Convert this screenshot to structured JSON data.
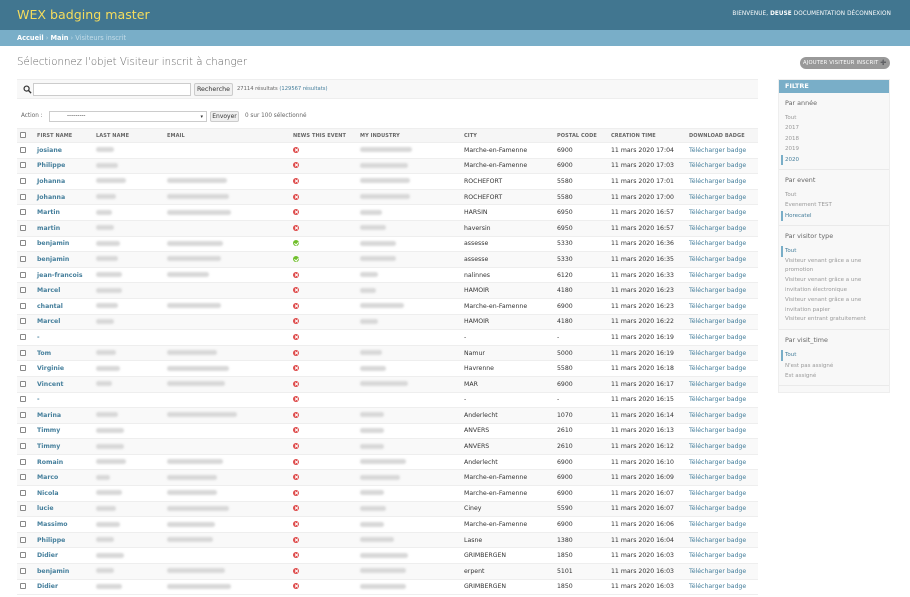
{
  "header": {
    "brand": "WEX badging master",
    "welcome": "BIENVENUE,",
    "username": "DEUSE",
    "documentation": "DOCUMENTATION",
    "logout": "DÉCONNEXION"
  },
  "breadcrumbs": {
    "home": "Accueil",
    "sep1": "›",
    "app": "Main",
    "sep2": "›",
    "current": "Visiteurs inscrit"
  },
  "page_title": "Sélectionnez l'objet Visiteur inscrit à changer",
  "add_button": "AJOUTER VISITEUR INSCRIT",
  "search": {
    "value": "",
    "button": "Recherche",
    "results": "27114 résultats",
    "total": "(129567 résultats)"
  },
  "actions": {
    "label": "Action :",
    "selected": "---------",
    "go": "Envoyer",
    "selected_count": "0 sur 100 sélectionné"
  },
  "table": {
    "headers": [
      "FIRST NAME",
      "LAST NAME",
      "EMAIL",
      "NEWS THIS EVENT",
      "MY INDUSTRY",
      "CITY",
      "POSTAL CODE",
      "CREATION TIME",
      "DOWNLOAD BADGE"
    ],
    "rows": [
      {
        "first": "josiane",
        "city": "Marche-en-Famenne",
        "postal": "6900",
        "time": "11 mars 2020 17:04",
        "news": "no",
        "has_ln": true,
        "has_email": false,
        "has_ind": true
      },
      {
        "first": "Philippe",
        "city": "Marche-en-Famenne",
        "postal": "6900",
        "time": "11 mars 2020 17:03",
        "news": "no",
        "has_ln": true,
        "has_email": false,
        "has_ind": true
      },
      {
        "first": "Johanna",
        "city": "ROCHEFORT",
        "postal": "5580",
        "time": "11 mars 2020 17:01",
        "news": "no",
        "has_ln": true,
        "has_email": true,
        "has_ind": true
      },
      {
        "first": "Johanna",
        "city": "ROCHEFORT",
        "postal": "5580",
        "time": "11 mars 2020 17:00",
        "news": "no",
        "has_ln": true,
        "has_email": true,
        "has_ind": true
      },
      {
        "first": "Martin",
        "city": "HARSIN",
        "postal": "6950",
        "time": "11 mars 2020 16:57",
        "news": "no",
        "has_ln": true,
        "has_email": true,
        "has_ind": true
      },
      {
        "first": "martin",
        "city": "haversin",
        "postal": "6950",
        "time": "11 mars 2020 16:57",
        "news": "no",
        "has_ln": true,
        "has_email": false,
        "has_ind": true
      },
      {
        "first": "benjamin",
        "city": "assesse",
        "postal": "5330",
        "time": "11 mars 2020 16:36",
        "news": "yes",
        "has_ln": true,
        "has_email": true,
        "has_ind": true
      },
      {
        "first": "benjamin",
        "city": "assesse",
        "postal": "5330",
        "time": "11 mars 2020 16:35",
        "news": "yes",
        "has_ln": true,
        "has_email": true,
        "has_ind": true
      },
      {
        "first": "jean-francois",
        "city": "nalinnes",
        "postal": "6120",
        "time": "11 mars 2020 16:33",
        "news": "no",
        "has_ln": true,
        "has_email": true,
        "has_ind": true
      },
      {
        "first": "Marcel",
        "city": "HAMOIR",
        "postal": "4180",
        "time": "11 mars 2020 16:23",
        "news": "no",
        "has_ln": true,
        "has_email": false,
        "has_ind": true
      },
      {
        "first": "chantal",
        "city": "Marche-en-Famenne",
        "postal": "6900",
        "time": "11 mars 2020 16:23",
        "news": "no",
        "has_ln": true,
        "has_email": true,
        "has_ind": true
      },
      {
        "first": "Marcel",
        "city": "HAMOIR",
        "postal": "4180",
        "time": "11 mars 2020 16:22",
        "news": "no",
        "has_ln": true,
        "has_email": false,
        "has_ind": true
      },
      {
        "first": "-",
        "city": "-",
        "postal": "-",
        "time": "11 mars 2020 16:19",
        "news": "no",
        "has_ln": false,
        "has_email": false,
        "has_ind": false,
        "dash_ln": true
      },
      {
        "first": "Tom",
        "city": "Namur",
        "postal": "5000",
        "time": "11 mars 2020 16:19",
        "news": "no",
        "has_ln": true,
        "has_email": true,
        "has_ind": true
      },
      {
        "first": "Virginie",
        "city": "Havrenne",
        "postal": "5580",
        "time": "11 mars 2020 16:18",
        "news": "no",
        "has_ln": true,
        "has_email": true,
        "has_ind": true
      },
      {
        "first": "Vincent",
        "city": "MAR",
        "postal": "6900",
        "time": "11 mars 2020 16:17",
        "news": "no",
        "has_ln": true,
        "has_email": true,
        "has_ind": true
      },
      {
        "first": "-",
        "city": "-",
        "postal": "-",
        "time": "11 mars 2020 16:15",
        "news": "no",
        "has_ln": false,
        "has_email": false,
        "has_ind": false,
        "dash_ln": true
      },
      {
        "first": "Marina",
        "city": "Anderlecht",
        "postal": "1070",
        "time": "11 mars 2020 16:14",
        "news": "no",
        "has_ln": true,
        "has_email": true,
        "has_ind": true
      },
      {
        "first": "Timmy",
        "city": "ANVERS",
        "postal": "2610",
        "time": "11 mars 2020 16:13",
        "news": "no",
        "has_ln": true,
        "has_email": false,
        "has_ind": true
      },
      {
        "first": "Timmy",
        "city": "ANVERS",
        "postal": "2610",
        "time": "11 mars 2020 16:12",
        "news": "no",
        "has_ln": true,
        "has_email": false,
        "has_ind": true
      },
      {
        "first": "Romain",
        "city": "Anderlecht",
        "postal": "6900",
        "time": "11 mars 2020 16:10",
        "news": "no",
        "has_ln": true,
        "has_email": true,
        "has_ind": true
      },
      {
        "first": "Marco",
        "city": "Marche-en-Famenne",
        "postal": "6900",
        "time": "11 mars 2020 16:09",
        "news": "no",
        "has_ln": true,
        "has_email": true,
        "has_ind": true
      },
      {
        "first": "Nicola",
        "city": "Marche-en-Famenne",
        "postal": "6900",
        "time": "11 mars 2020 16:07",
        "news": "no",
        "has_ln": true,
        "has_email": true,
        "has_ind": true
      },
      {
        "first": "lucie",
        "city": "Ciney",
        "postal": "5590",
        "time": "11 mars 2020 16:07",
        "news": "no",
        "has_ln": true,
        "has_email": true,
        "has_ind": true
      },
      {
        "first": "Massimo",
        "city": "Marche-en-Famenne",
        "postal": "6900",
        "time": "11 mars 2020 16:06",
        "news": "no",
        "has_ln": true,
        "has_email": true,
        "has_ind": true
      },
      {
        "first": "Philippe",
        "city": "Lasne",
        "postal": "1380",
        "time": "11 mars 2020 16:04",
        "news": "no",
        "has_ln": true,
        "has_email": true,
        "has_ind": true
      },
      {
        "first": "Didier",
        "city": "GRIMBERGEN",
        "postal": "1850",
        "time": "11 mars 2020 16:03",
        "news": "no",
        "has_ln": true,
        "has_email": false,
        "has_ind": true
      },
      {
        "first": "benjamin",
        "city": "erpent",
        "postal": "5101",
        "time": "11 mars 2020 16:03",
        "news": "no",
        "has_ln": true,
        "has_email": true,
        "has_ind": true
      },
      {
        "first": "Didier",
        "city": "GRIMBERGEN",
        "postal": "1850",
        "time": "11 mars 2020 16:03",
        "news": "no",
        "has_ln": true,
        "has_email": true,
        "has_ind": true
      }
    ],
    "download_label": "Télécharger badge"
  },
  "filter": {
    "title": "FILTRE",
    "groups": [
      {
        "heading": "Par année",
        "options": [
          "Tout",
          "2017",
          "2018",
          "2019",
          "2020"
        ],
        "selected": 4
      },
      {
        "heading": "Par event",
        "options": [
          "Tout",
          "Evenement TEST",
          "Horecatel"
        ],
        "selected": 2
      },
      {
        "heading": "Par visitor type",
        "options": [
          "Tout",
          "Visiteur venant grâce a une promotion",
          "Visiteur venant grâce a une invitation électronique",
          "Visiteur venant grâce a une invitation papier",
          "Visiteur entrant gratuitement"
        ],
        "selected": 0
      },
      {
        "heading": "Par visit_time",
        "options": [
          "Tout",
          "N'est pas assigné",
          "Est assigné"
        ],
        "selected": 0
      }
    ]
  },
  "colors": {
    "header": "#417690",
    "brand": "#f5dd5d",
    "breadcrumbs": "#79aec8",
    "link": "#447e9b",
    "no_icon": "#dd4646",
    "yes_icon": "#70bf2b"
  }
}
